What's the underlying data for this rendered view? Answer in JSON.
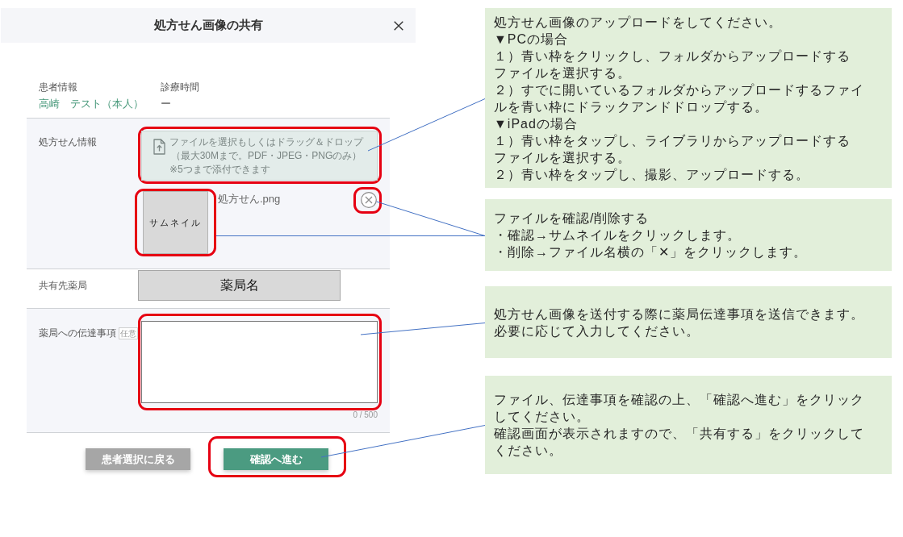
{
  "dialog": {
    "title": "処方せん画像の共有",
    "patient": {
      "label": "患者情報",
      "value": "高崎　テスト（本人）"
    },
    "visit_time": {
      "label": "診療時間",
      "value": "ー"
    },
    "prescription": {
      "label": "処方せん情報",
      "dropzone": {
        "instruction": "ファイルを選択もしくはドラッグ＆ドロップ",
        "limits": "（最大30Mまで。PDF・JPEG・PNGのみ）",
        "note": "※5つまで添付できます",
        "highlighted": true
      },
      "file": {
        "thumbnail": {
          "label": "サムネイル",
          "highlighted": true
        },
        "name": "処方せん.png",
        "remove": {
          "highlighted": true
        }
      }
    },
    "pharmacy": {
      "label": "共有先薬局",
      "value": "薬局名"
    },
    "message": {
      "label": "薬局への伝達事項",
      "tag": "任意",
      "counter": "0 / 500",
      "highlighted": true
    },
    "buttons": [
      {
        "kind": "back",
        "label": "患者選択に戻る",
        "highlighted": false
      },
      {
        "kind": "next",
        "label": "確認へ進む",
        "highlighted": true
      }
    ]
  },
  "callouts": [
    {
      "lines": [
        "処方せん画像のアップロードをしてください。",
        "▼PCの場合",
        "１）青い枠をクリックし、フォルダからアップロードする",
        "ファイルを選択する。",
        "２）すでに開いているフォルダからアップロードするファイ",
        "ルを青い枠にドラックアンドドロップする。",
        "▼iPadの場合",
        "１）青い枠をタップし、ライブラリからアップロードする",
        "ファイルを選択する。",
        "２）青い枠をタップし、撮影、アップロードする。"
      ]
    },
    {
      "lines": [
        "ファイルを確認/削除する",
        "・確認→サムネイルをクリックします。",
        "・削除→ファイル名横の「✕」をクリックします。"
      ]
    },
    {
      "lines": [
        "処方せん画像を送付する際に薬局伝達事項を送信できます。",
        "必要に応じて入力してください。"
      ]
    },
    {
      "lines": [
        "ファイル、伝達事項を確認の上、「確認へ進む」をクリック",
        "してください。",
        "確認画面が表示されますので、「共有する」をクリックして",
        "ください。"
      ]
    }
  ]
}
